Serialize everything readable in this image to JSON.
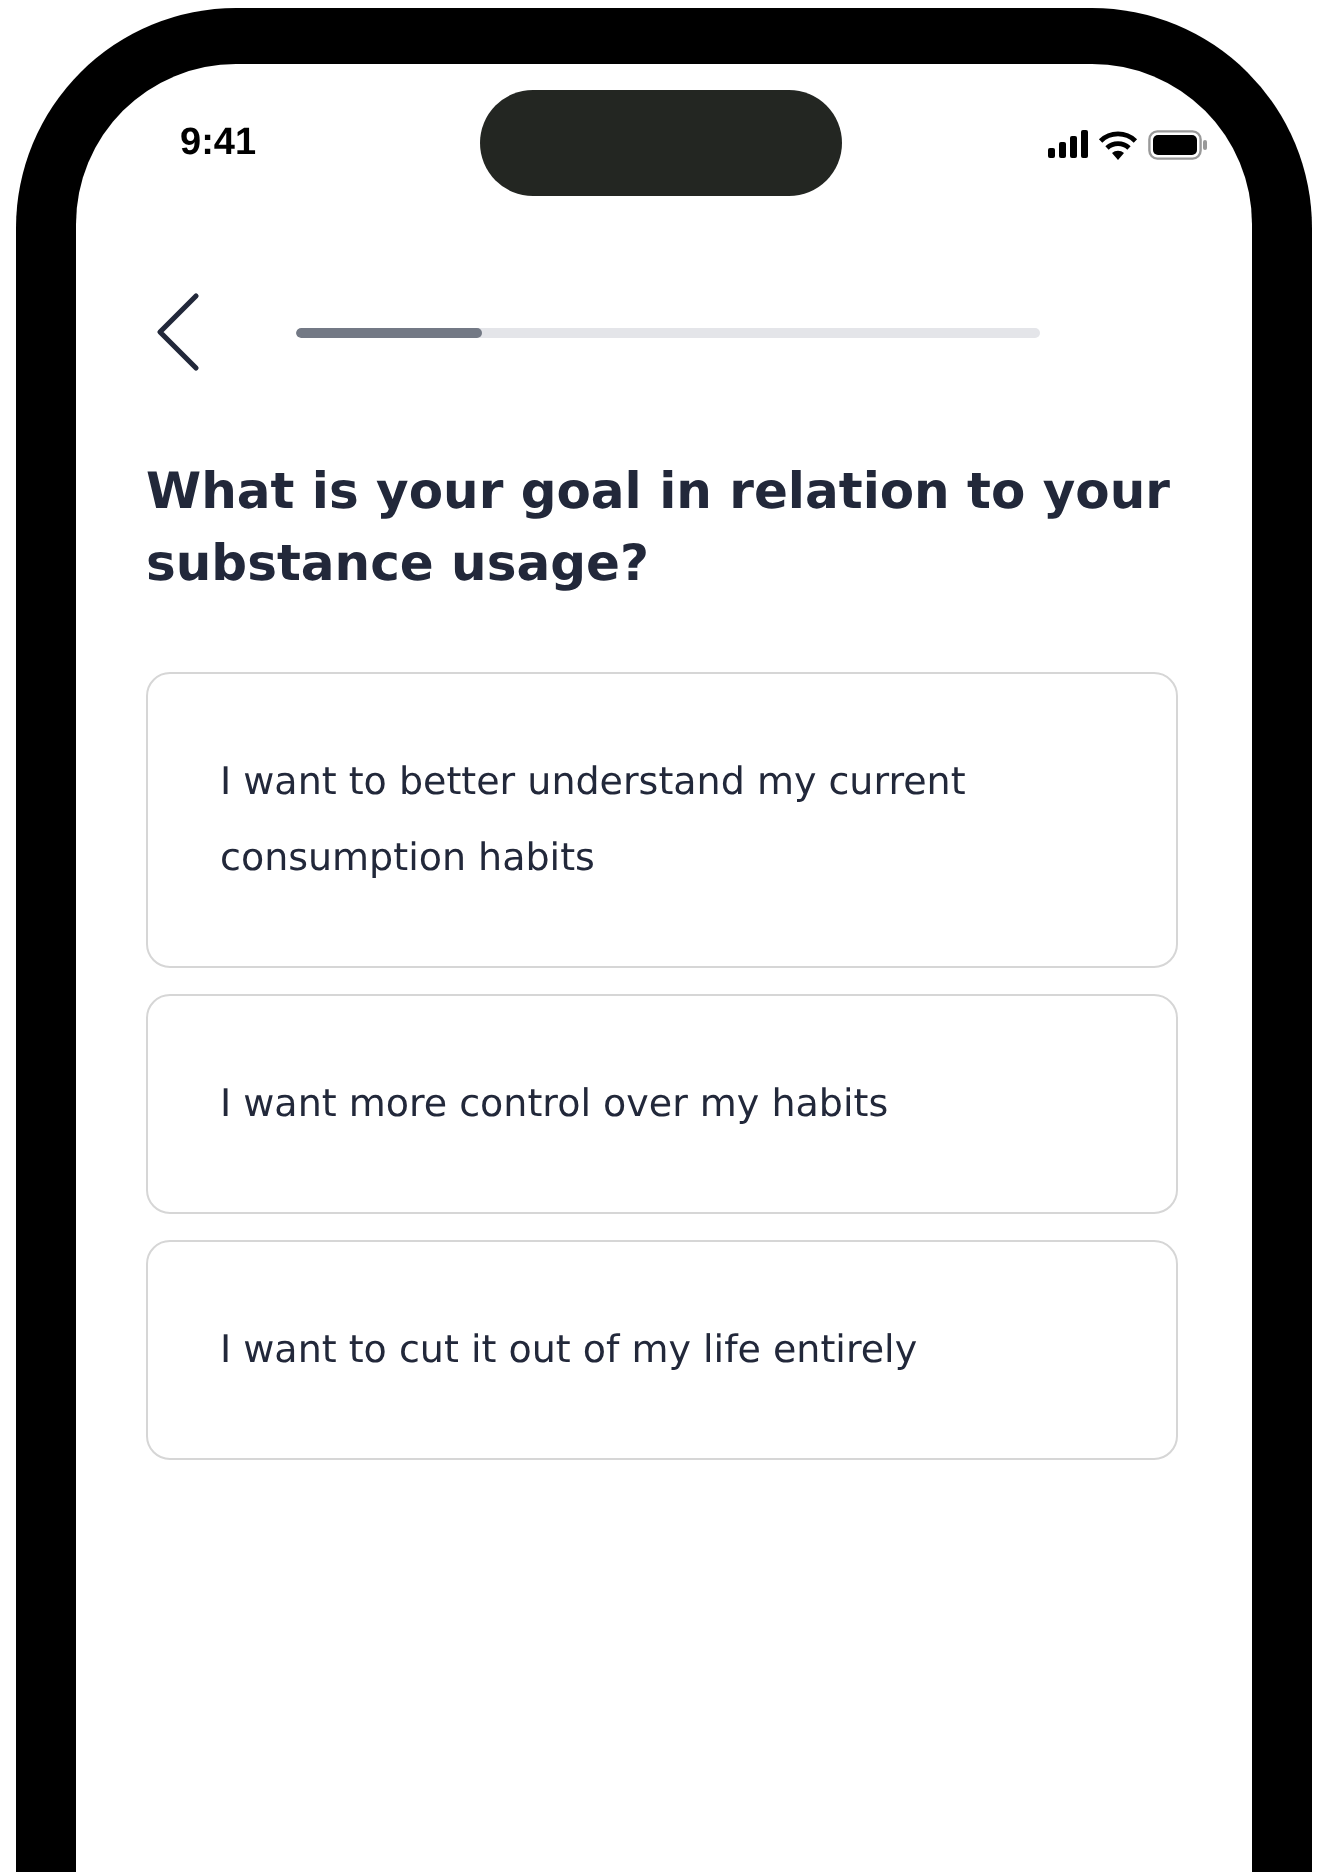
{
  "status_bar": {
    "time": "9:41"
  },
  "progress": {
    "level": 0.25
  },
  "question": "What is your goal in relation to your substance usage?",
  "options": [
    {
      "label": "I want to better understand my current consumption habits",
      "selected": false
    },
    {
      "label": "I want more control over my habits",
      "selected": false
    },
    {
      "label": "I want to cut it out of my life entirely",
      "selected": false
    }
  ]
}
